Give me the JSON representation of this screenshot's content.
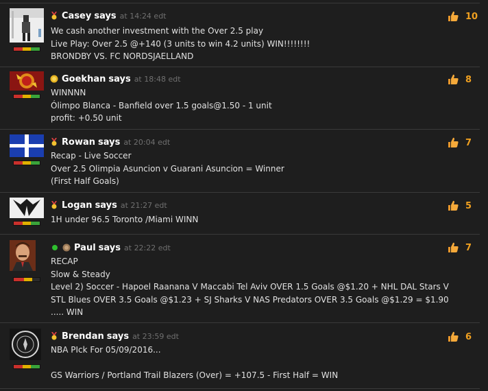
{
  "posts": [
    {
      "name": "Casey",
      "says": "says",
      "prefix": "at",
      "time": "14:24 edt",
      "likes": "10",
      "badge": "award-medal-icon",
      "lines": [
        "We cash another investment with the Over 2.5 play",
        "Live Play: Over 2.5 @+140 (3 units to win 4.2 units) WIN!!!!!!!!",
        "BRONDBY VS. FC NORDSJAELLAND"
      ]
    },
    {
      "name": "Goekhan",
      "says": "says",
      "prefix": "at",
      "time": "18:48 edt",
      "likes": "8",
      "badge": "gold-medal-icon",
      "lines": [
        "WINNNN",
        "Ólimpo Blanca - Banfield over 1.5 goals@1.50 - 1 unit",
        "profit: +0.50 unit"
      ]
    },
    {
      "name": "Rowan",
      "says": "says",
      "prefix": "at",
      "time": "20:04 edt",
      "likes": "7",
      "badge": "award-medal-icon",
      "lines": [
        "Recap - Live Soccer",
        "Over 2.5 Olimpia Asuncion v Guarani Asuncion = Winner",
        "(First Half Goals)"
      ]
    },
    {
      "name": "Logan",
      "says": "says",
      "prefix": "at",
      "time": "21:27 edt",
      "likes": "5",
      "badge": "award-medal-icon",
      "lines": [
        "1H under 96.5 Toronto /Miami WINN"
      ]
    },
    {
      "name": "Paul",
      "says": "says",
      "prefix": "at",
      "time": "22:22 edt",
      "likes": "7",
      "badge": "bronze-medal-icon",
      "online": true,
      "lines": [
        "RECAP",
        "Slow & Steady",
        "Level 2) Soccer - Hapoel Raanana V Maccabi Tel Aviv OVER 1.5 Goals @$1.20 + NHL DAL Stars V",
        "STL Blues OVER 3.5 Goals @$1.23 + SJ Sharks V NAS Predators OVER 3.5 Goals @$1.29 = $1.90",
        "..... WIN"
      ]
    },
    {
      "name": "Brendan",
      "says": "says",
      "prefix": "at",
      "time": "23:59 edt",
      "likes": "6",
      "badge": "award-medal-icon",
      "lines": [
        "NBA PIck For 05/09/2016...",
        "",
        "GS Warriors / Portland Trail Blazers (Over) = +107.5 - First Half = WIN"
      ]
    }
  ],
  "colors": {
    "background": "#1e1e1e",
    "like_count": "#f0a020",
    "timestamp": "#707070",
    "online": "#2fbf2f"
  }
}
